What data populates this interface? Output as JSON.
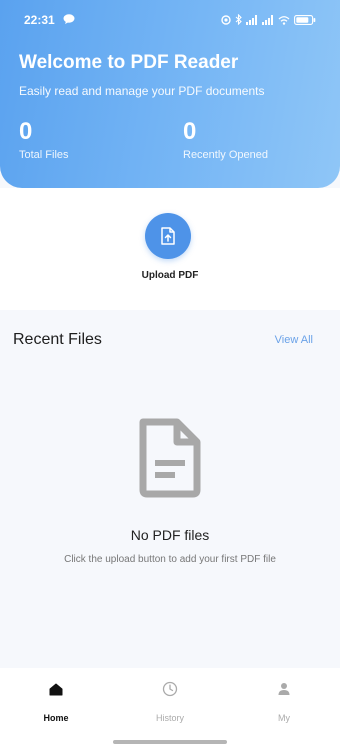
{
  "status_bar": {
    "time": "22:31"
  },
  "header": {
    "title": "Welcome to PDF Reader",
    "subtitle": "Easily read and manage your PDF documents",
    "stats": [
      {
        "value": "0",
        "label": "Total Files"
      },
      {
        "value": "0",
        "label": "Recently Opened"
      }
    ]
  },
  "upload": {
    "label": "Upload PDF",
    "icon": "upload-file-icon"
  },
  "recent": {
    "title": "Recent Files",
    "view_all": "View All",
    "empty_title": "No PDF files",
    "empty_desc": "Click the upload button to add your first PDF file",
    "empty_icon": "document-icon"
  },
  "nav": {
    "items": [
      {
        "label": "Home",
        "icon": "home-icon",
        "active": true
      },
      {
        "label": "History",
        "icon": "clock-icon",
        "active": false
      },
      {
        "label": "My",
        "icon": "person-icon",
        "active": false
      }
    ]
  },
  "colors": {
    "accent": "#4e93e8",
    "header_start": "#5aa2ef",
    "header_end": "#8fc6f7",
    "link": "#6aa2e8"
  }
}
